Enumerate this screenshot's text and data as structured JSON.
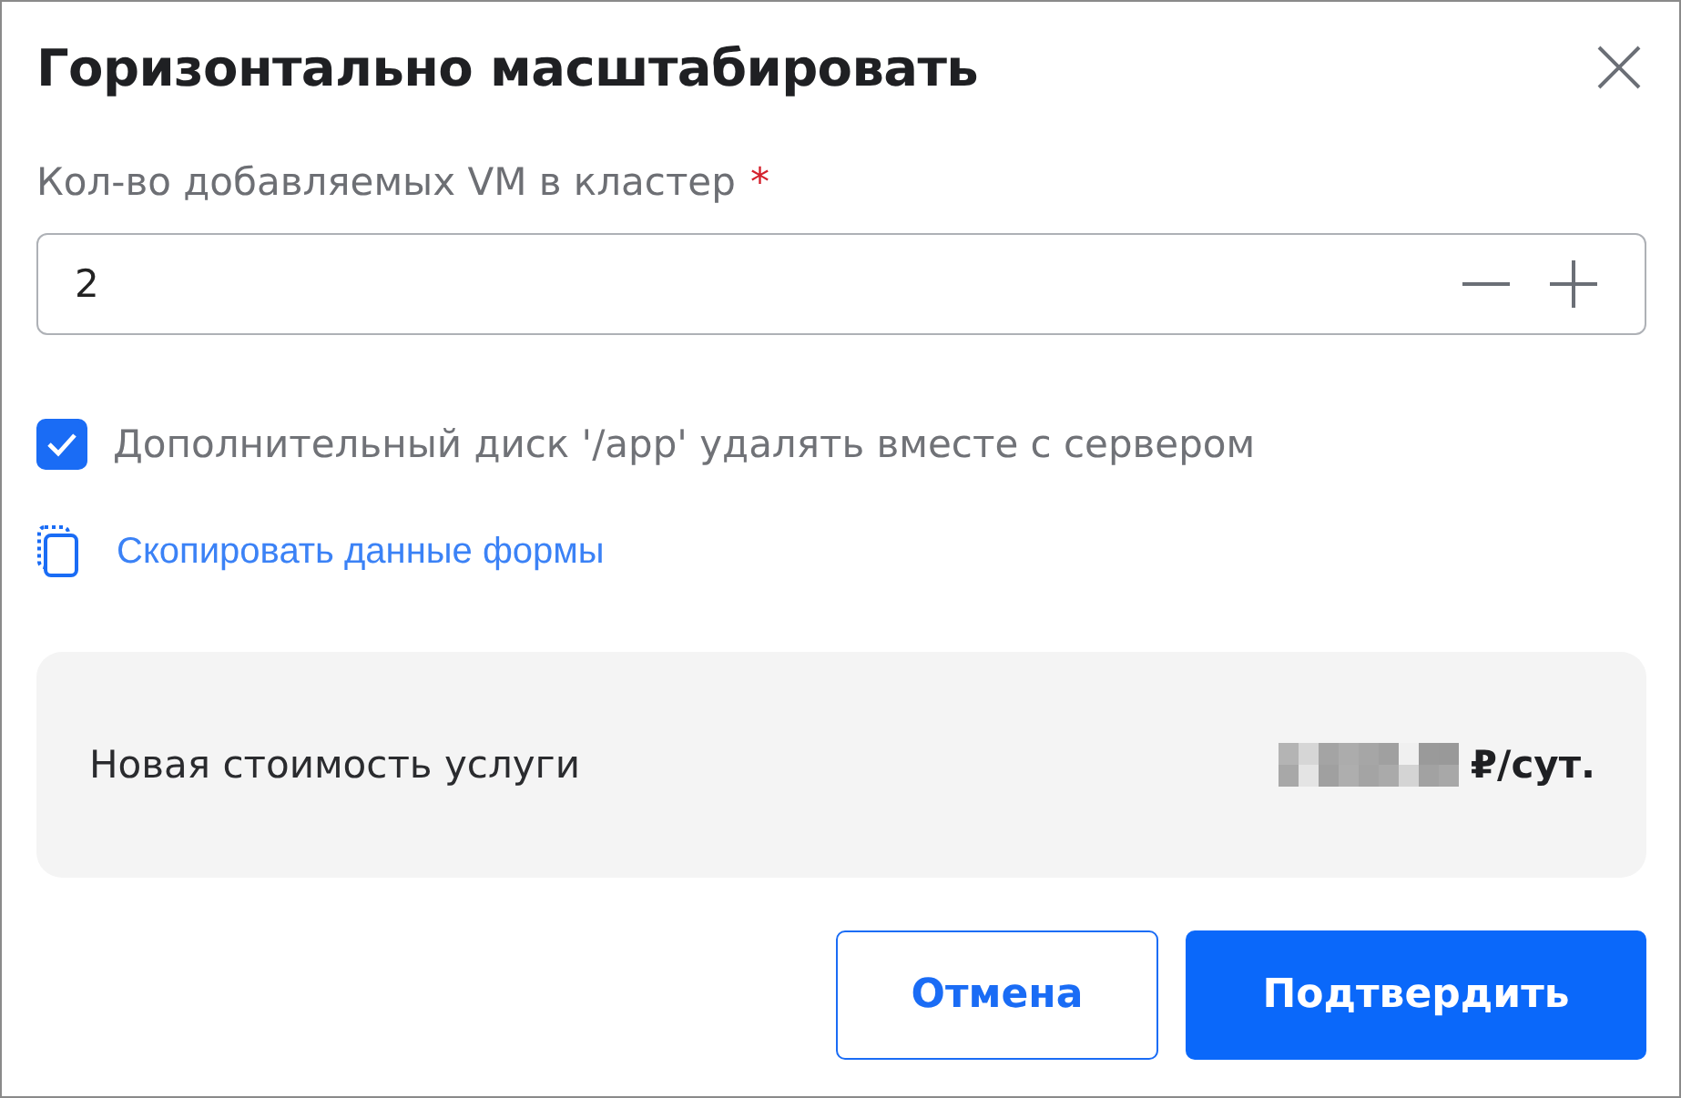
{
  "dialog": {
    "title": "Горизонтально масштабировать"
  },
  "count_field": {
    "label": "Кол-во добавляемых VM в кластер",
    "required_mark": "*",
    "value": "2"
  },
  "delete_disk": {
    "label": "Дополнительный диск '/app' удалять вместе с сервером",
    "checked": true
  },
  "copy_link": {
    "label": "Скопировать данные формы"
  },
  "price": {
    "label": "Новая стоимость услуги",
    "unit": "₽/сут."
  },
  "buttons": [
    {
      "label": "Отмена",
      "kind": "secondary"
    },
    {
      "label": "Подтвердить",
      "kind": "primary"
    }
  ]
}
